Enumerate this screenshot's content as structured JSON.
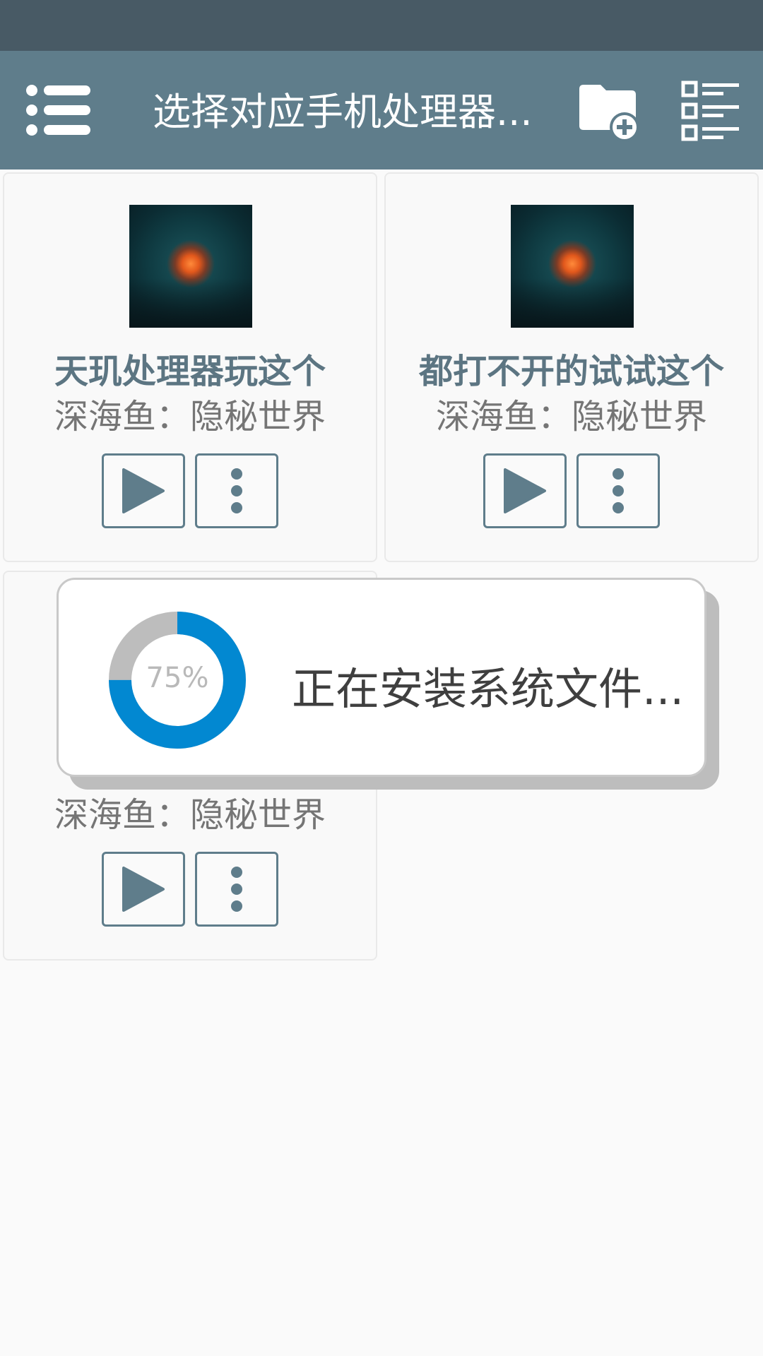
{
  "toolbar": {
    "title": "选择对应手机处理器...",
    "menu_icon": "menu-icon",
    "new_folder_icon": "folder-add-icon",
    "list_icon": "list-view-icon"
  },
  "cards": [
    {
      "title": "天玑处理器玩这个",
      "subtitle": "深海鱼：隐秘世界"
    },
    {
      "title": "都打不开的试试这个",
      "subtitle": "深海鱼：隐秘世界"
    },
    {
      "title": "",
      "subtitle": "深海鱼：隐秘世界"
    }
  ],
  "dialog": {
    "progress_percent": 75,
    "progress_label": "75%",
    "message": "正在安装系统文件..."
  },
  "colors": {
    "status_bar": "#485a65",
    "toolbar": "#5f7d8b",
    "accent": "#5f7d8b",
    "progress": "#0288d1",
    "progress_track": "#bdbdbd"
  }
}
